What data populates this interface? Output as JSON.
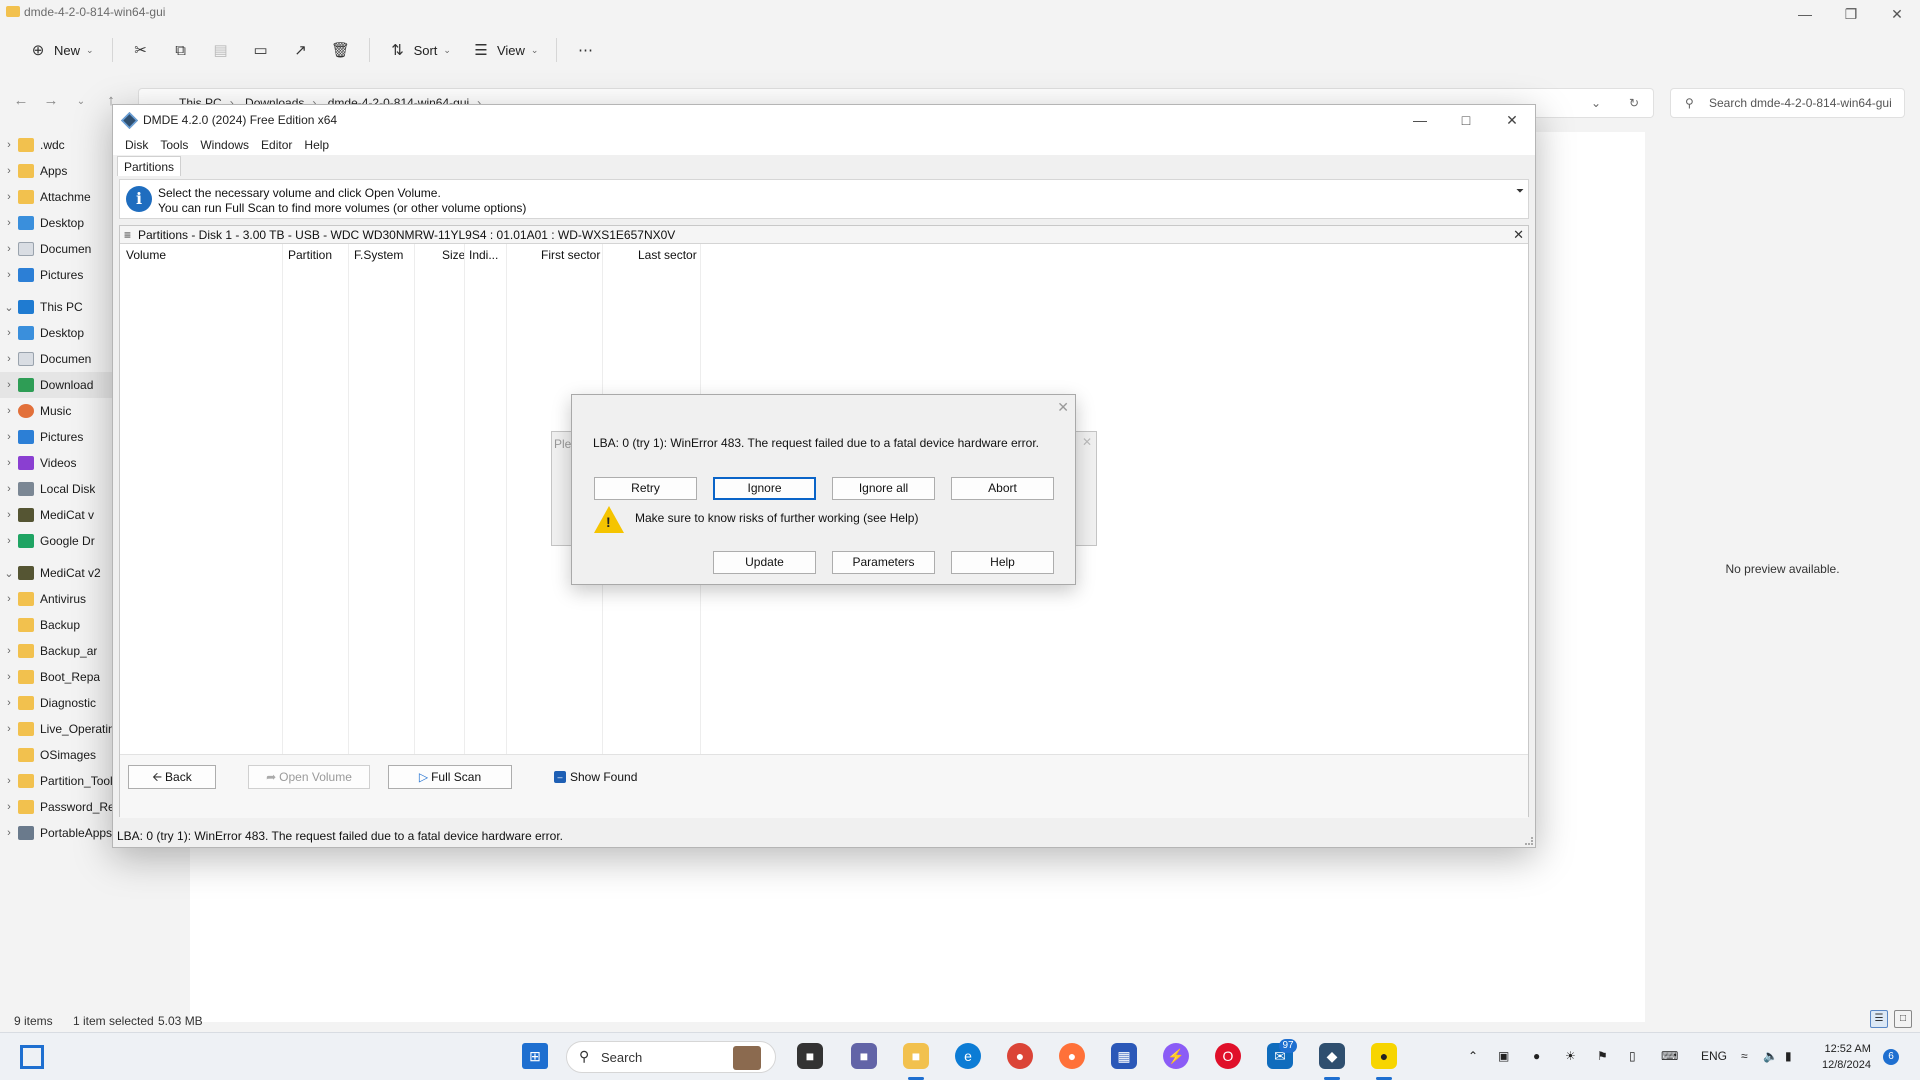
{
  "explorer": {
    "title": "dmde-4-2-0-814-win64-gui",
    "toolbar": {
      "new_label": "New",
      "sort_label": "Sort",
      "view_label": "View"
    },
    "address": {
      "crumbs": [
        "This PC",
        "Downloads",
        "dmde-4-2-0-814-win64-gui"
      ]
    },
    "search_placeholder": "Search dmde-4-2-0-814-win64-gui",
    "nav_items": [
      {
        "label": ".wdc",
        "icon": "folder-icon"
      },
      {
        "label": "Apps",
        "icon": "folder-icon"
      },
      {
        "label": "Attachme",
        "icon": "folder-icon"
      },
      {
        "label": "Desktop",
        "icon": "desktop-icon"
      },
      {
        "label": "Documen",
        "icon": "documents-icon"
      },
      {
        "label": "Pictures",
        "icon": "pictures-icon"
      },
      {
        "label": "This PC",
        "icon": "computer-icon"
      },
      {
        "label": "Desktop",
        "icon": "desktop-icon"
      },
      {
        "label": "Documen",
        "icon": "documents-icon"
      },
      {
        "label": "Download",
        "icon": "download-icon"
      },
      {
        "label": "Music",
        "icon": "music-icon"
      },
      {
        "label": "Pictures",
        "icon": "pictures-icon"
      },
      {
        "label": "Videos",
        "icon": "videos-icon"
      },
      {
        "label": "Local Disk",
        "icon": "disk-icon"
      },
      {
        "label": "MediCat v",
        "icon": "drive-icon"
      },
      {
        "label": "Google Dr",
        "icon": "google-drive-icon"
      },
      {
        "label": "MediCat v2",
        "icon": "drive-icon"
      },
      {
        "label": "Antivirus",
        "icon": "folder-icon"
      },
      {
        "label": "Backup",
        "icon": "folder-icon"
      },
      {
        "label": "Backup_ar",
        "icon": "folder-icon"
      },
      {
        "label": "Boot_Repa",
        "icon": "folder-icon"
      },
      {
        "label": "Diagnostic",
        "icon": "folder-icon"
      },
      {
        "label": "Live_Operating_Syste",
        "icon": "folder-icon"
      },
      {
        "label": "OSimages",
        "icon": "folder-icon"
      },
      {
        "label": "Partition_Tools",
        "icon": "folder-icon"
      },
      {
        "label": "Password_Removal",
        "icon": "folder-icon"
      },
      {
        "label": "PortableApps",
        "icon": "folder-icon"
      }
    ],
    "preview_message": "No preview available.",
    "status": {
      "items": "9 items",
      "selected": "1 item selected",
      "size": "5.03 MB"
    }
  },
  "dmde": {
    "title": "DMDE 4.2.0 (2024) Free Edition x64",
    "menu": [
      "Disk",
      "Tools",
      "Windows",
      "Editor",
      "Help"
    ],
    "tab": "Partitions",
    "info_line1": "Select the necessary volume and click Open Volume.",
    "info_line2": "You can run Full Scan to find more volumes (or other volume options)",
    "partitions_title": "Partitions - Disk 1 - 3.00 TB - USB - WDC WD30NMRW-11YL9S4 : 01.01A01 : WD-WXS1E657NX0V",
    "columns": [
      "Volume",
      "Partition",
      "F.System",
      "Size",
      "Indi...",
      "First sector",
      "Last sector"
    ],
    "buttons": {
      "back": "Back",
      "open_volume": "Open Volume",
      "full_scan": "Full Scan",
      "show_found": "Show Found"
    },
    "status_text": "LBA: 0 (try 1): WinError 483. The request failed due to a fatal device hardware error."
  },
  "bg_dialog": {
    "partial_text": "Ple"
  },
  "error_dialog": {
    "message": "LBA: 0 (try 1): WinError 483. The request failed due to a fatal device hardware error.",
    "warning": "Make sure to know risks of further working (see Help)",
    "buttons": {
      "retry": "Retry",
      "ignore": "Ignore",
      "ignore_all": "Ignore all",
      "abort": "Abort",
      "update": "Update",
      "parameters": "Parameters",
      "help": "Help"
    }
  },
  "taskbar": {
    "search_label": "Search",
    "mail_badge": "97",
    "language": "ENG",
    "time": "12:52 AM",
    "date": "12/8/2024",
    "notifications": "6"
  }
}
